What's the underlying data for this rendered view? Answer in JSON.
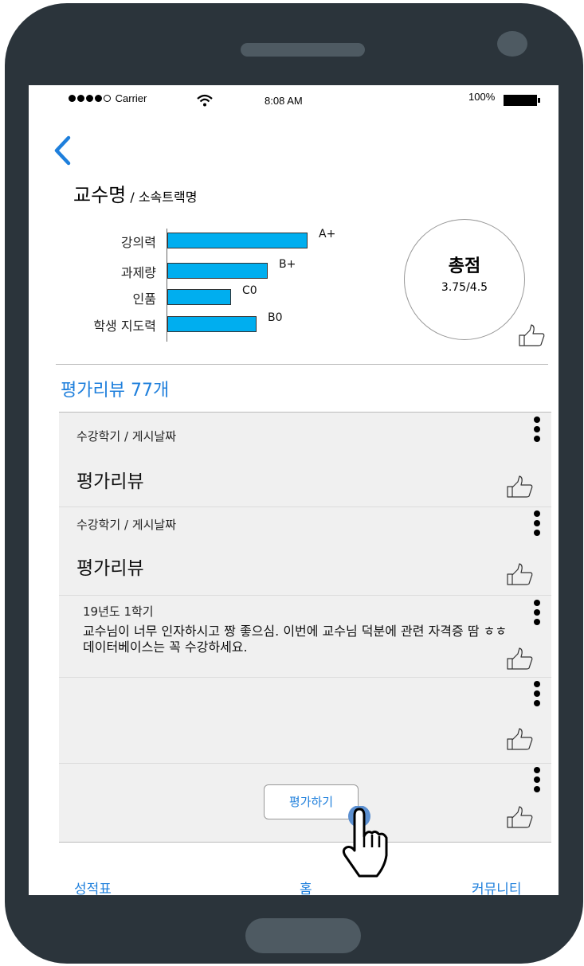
{
  "status_bar": {
    "signal_label": "Carrier",
    "time": "8:08 AM",
    "battery": "100%"
  },
  "professor": {
    "name": "교수명",
    "track": " / 소속트랙명"
  },
  "ratings": {
    "items": [
      {
        "label": "강의력",
        "grade": "A+",
        "value": 0.88
      },
      {
        "label": "과제량",
        "grade": "B+",
        "value": 0.63
      },
      {
        "label": "인품",
        "grade": "C0",
        "value": 0.4
      },
      {
        "label": "학생 지도력",
        "grade": "B0",
        "value": 0.56
      }
    ],
    "total_label": "총점",
    "total_value": "3.75/4.5"
  },
  "reviews": {
    "header": "평가리뷰 77개",
    "items": [
      {
        "meta": "수강학기 / 게시날짜",
        "title": "평가리뷰",
        "body": ""
      },
      {
        "meta": "수강학기 / 게시날짜",
        "title": "평가리뷰",
        "body": ""
      },
      {
        "meta": "19년도 1학기",
        "title": "",
        "body": "교수님이 너무 인자하시고 짱 좋으심. 이번에 교수님 덕분에 관련 자격증 땀 ㅎㅎ 데이터베이스는 꼭 수강하세요."
      }
    ],
    "evaluate_button": "평가하기"
  },
  "bottom_nav": {
    "grades": "성적표",
    "home": "홈",
    "community": "커뮤니티"
  },
  "colors": {
    "accent": "#1e7fdc",
    "bar": "#00aeef",
    "device": "#2b343b"
  }
}
